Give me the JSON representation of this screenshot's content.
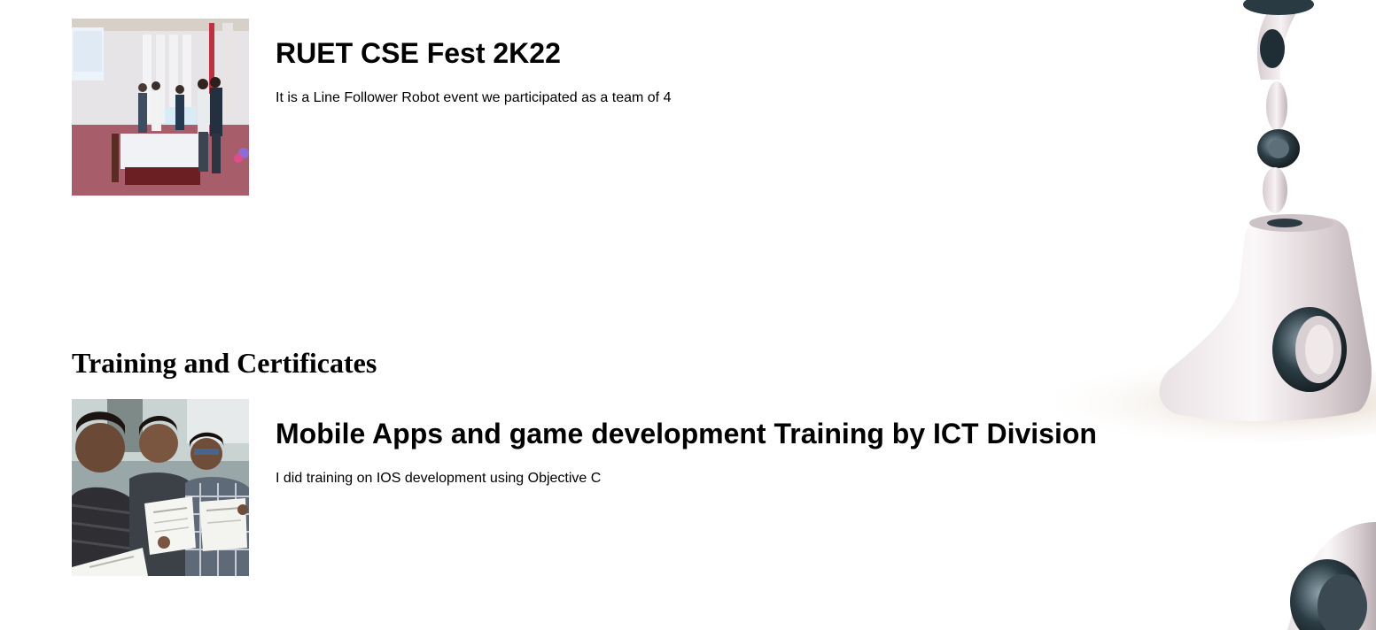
{
  "events": [
    {
      "title": "RUET CSE Fest 2K22",
      "description": "It is a Line Follower Robot event we participated as a team of 4"
    }
  ],
  "training_section": {
    "heading": "Training and Certificates",
    "items": [
      {
        "title": "Mobile Apps and game development Training by ICT Division",
        "description": "I did training on IOS development using Objective C"
      }
    ]
  }
}
